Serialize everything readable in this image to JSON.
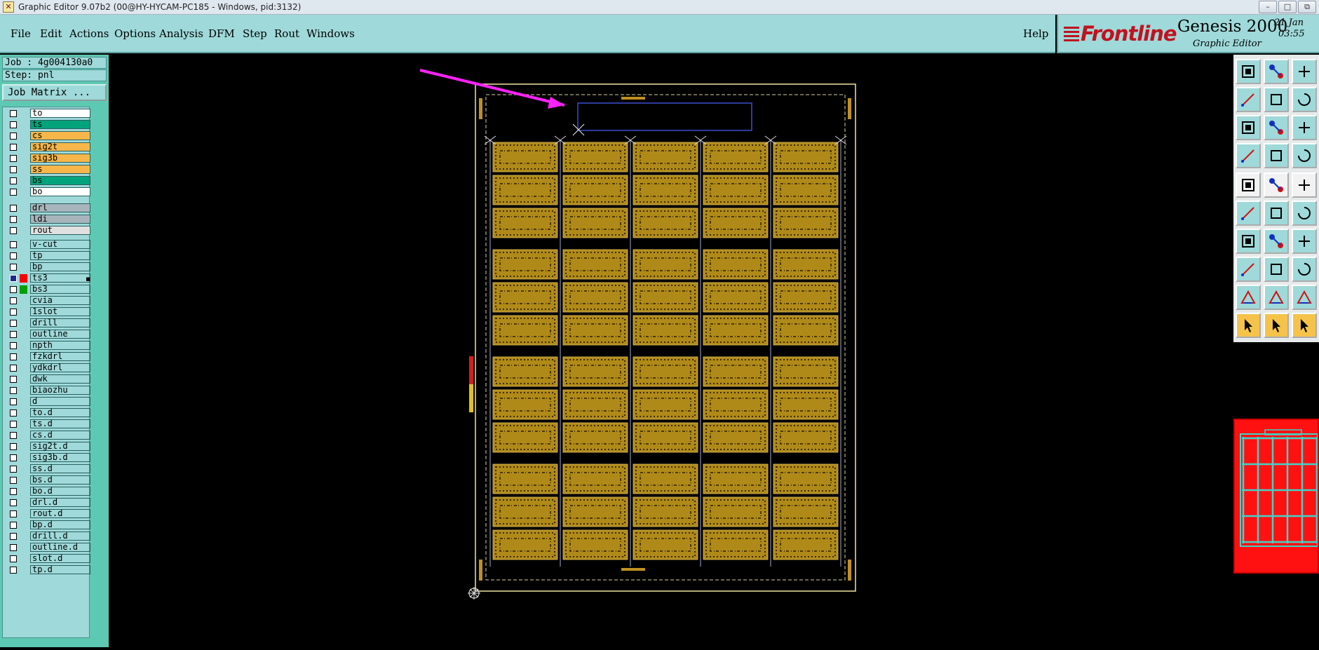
{
  "window": {
    "title": "Graphic Editor 9.07b2 (00@HY-HYCAM-PC185 - Windows, pid:3132)",
    "controls": [
      "–",
      "□",
      "⧉"
    ]
  },
  "menu": {
    "items": [
      "File",
      "Edit",
      "Actions",
      "Options",
      "Analysis",
      "DFM",
      "Step",
      "Rout",
      "Windows"
    ],
    "help": "Help"
  },
  "brand": {
    "logo": "Frontline",
    "product": "Genesis 2000",
    "subtitle": "Graphic Editor",
    "date": "21 Jan",
    "time": "03:55"
  },
  "job": {
    "label": "Job : 4g004130a0",
    "step": "Step: pnl",
    "matrix_button": "Job Matrix ..."
  },
  "colors": {
    "panel": "#9fd9d9",
    "layer_white": "#ffffff",
    "layer_green": "#00a37a",
    "layer_orange": "#f7b64a",
    "layer_gray": "#a8b4bc",
    "layer_light": "#e0e0e0",
    "board_copper": "#b08a18",
    "board_outline": "#f0e6a0",
    "highlight_box": "#3a4fd0",
    "arrow": "#ff22ff",
    "minimap_bg": "#ff1111",
    "minimap_grid": "#43d1c8"
  },
  "layers": {
    "group1": [
      {
        "name": "to",
        "color": "#ffffff"
      },
      {
        "name": "ts",
        "color": "#00a37a"
      },
      {
        "name": "cs",
        "color": "#f7b64a"
      },
      {
        "name": "sig2t",
        "color": "#f7b64a"
      },
      {
        "name": "sig3b",
        "color": "#f7b64a"
      },
      {
        "name": "ss",
        "color": "#f7b64a"
      },
      {
        "name": "bs",
        "color": "#00a37a"
      },
      {
        "name": "bo",
        "color": "#ffffff"
      }
    ],
    "group2": [
      {
        "name": "drl",
        "color": "#a8b4bc"
      },
      {
        "name": "ldi",
        "color": "#a8b4bc"
      },
      {
        "name": "rout",
        "color": "#e0e0e0"
      }
    ],
    "group3": [
      {
        "name": "v-cut"
      },
      {
        "name": "tp"
      },
      {
        "name": "bp"
      },
      {
        "name": "ts3",
        "checked": true,
        "swatch": "#ff0000",
        "marker": "■"
      },
      {
        "name": "bs3",
        "swatch": "#00a000"
      },
      {
        "name": "cvia"
      },
      {
        "name": "1slot"
      },
      {
        "name": "drill"
      },
      {
        "name": "outline"
      },
      {
        "name": "npth"
      },
      {
        "name": "fzkdrl"
      },
      {
        "name": "ydkdrl"
      },
      {
        "name": "dwk"
      },
      {
        "name": "biaozhu"
      },
      {
        "name": "d"
      },
      {
        "name": "to.d"
      },
      {
        "name": "ts.d"
      },
      {
        "name": "cs.d"
      },
      {
        "name": "sig2t.d"
      },
      {
        "name": "sig3b.d"
      },
      {
        "name": "ss.d"
      },
      {
        "name": "bs.d"
      },
      {
        "name": "bo.d"
      },
      {
        "name": "drl.d"
      },
      {
        "name": "rout.d"
      },
      {
        "name": "bp.d"
      },
      {
        "name": "drill.d"
      },
      {
        "name": "outline.d"
      },
      {
        "name": "slot.d"
      },
      {
        "name": "tp.d"
      }
    ]
  },
  "board": {
    "columns": 5,
    "rows": 12,
    "row_groups": 4
  },
  "tools": [
    "open-job-icon",
    "save-icon",
    "home-icon",
    "zoom-left-icon",
    "zoom-right-icon",
    "zoom-back-icon",
    "fit-screen-icon",
    "zoom-center-icon",
    "ratio-1-2-icon",
    "snap-settings-icon",
    "grid-icon",
    "layer-toggle-icon",
    "camera-icon",
    "transform-icon",
    "measure-ruler-icon",
    "connect-nodes-icon",
    "delete-feature-icon",
    "line-add-icon",
    "angle-line-icon",
    "pen-draw-icon",
    "arc-icon",
    "pad-add-icon",
    "horizontal-line-icon",
    "dimension-icon",
    "triangle-outline-icon",
    "text-a-icon",
    "text-a-bold-icon",
    "select-pointer-icon",
    "select-box-icon",
    "select-filter-icon"
  ],
  "minimap": {
    "columns": 5,
    "rows": 4
  }
}
